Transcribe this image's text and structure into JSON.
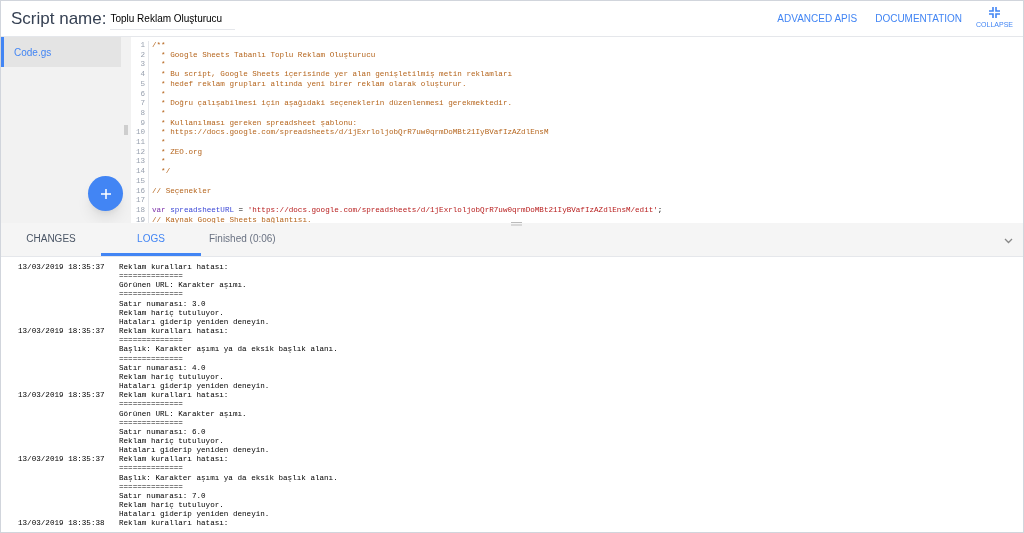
{
  "header": {
    "label": "Script name:",
    "script_name": "Toplu Reklam Oluşturucu",
    "links": [
      "ADVANCED APIS",
      "DOCUMENTATION"
    ],
    "collapse_label": "COLLAPSE"
  },
  "files": [
    {
      "name": "Code.gs",
      "selected": true
    }
  ],
  "editor": {
    "lines": [
      {
        "number": "1",
        "segments": [
          {
            "text": "/**",
            "kind": "comment"
          }
        ]
      },
      {
        "number": "2",
        "segments": [
          {
            "text": "  * Google Sheets Tabanlı Toplu Reklam Oluşturucu",
            "kind": "comment"
          }
        ]
      },
      {
        "number": "3",
        "segments": [
          {
            "text": "  *",
            "kind": "comment"
          }
        ]
      },
      {
        "number": "4",
        "segments": [
          {
            "text": "  * Bu script, Google Sheets içerisinde yer alan genişletilmiş metin reklamları",
            "kind": "comment"
          }
        ]
      },
      {
        "number": "5",
        "segments": [
          {
            "text": "  * hedef reklam grupları altında yeni birer reklam olarak oluşturur.",
            "kind": "comment"
          }
        ]
      },
      {
        "number": "6",
        "segments": [
          {
            "text": "  *",
            "kind": "comment"
          }
        ]
      },
      {
        "number": "7",
        "segments": [
          {
            "text": "  * Doğru çalışabilmesi için aşağıdaki seçeneklerin düzenlenmesi gerekmektedir.",
            "kind": "comment"
          }
        ]
      },
      {
        "number": "8",
        "segments": [
          {
            "text": "  *",
            "kind": "comment"
          }
        ]
      },
      {
        "number": "9",
        "segments": [
          {
            "text": "  * Kullanılması gereken spreadsheet şablonu:",
            "kind": "comment"
          }
        ]
      },
      {
        "number": "10",
        "segments": [
          {
            "text": "  * https://docs.google.com/spreadsheets/d/1jExrloljobQrR7uw0qrmDoMBt21IyBVafIzAZdlEnsM",
            "kind": "comment"
          }
        ]
      },
      {
        "number": "11",
        "segments": [
          {
            "text": "  *",
            "kind": "comment"
          }
        ]
      },
      {
        "number": "12",
        "segments": [
          {
            "text": "  * ZEO.org",
            "kind": "comment"
          }
        ]
      },
      {
        "number": "13",
        "segments": [
          {
            "text": "  *",
            "kind": "comment"
          }
        ]
      },
      {
        "number": "14",
        "segments": [
          {
            "text": "  */",
            "kind": "comment"
          }
        ]
      },
      {
        "number": "15"
      },
      {
        "number": "16",
        "segments": [
          {
            "text": "// Seçenekler",
            "kind": "comment"
          }
        ]
      },
      {
        "number": "17"
      },
      {
        "number": "18",
        "segments": [
          {
            "text": "var",
            "kind": "keyword"
          },
          {
            "text": " spreadsheetURL",
            "kind": "variable"
          },
          {
            "text": " = ",
            "kind": "plain"
          },
          {
            "text": "'https://docs.google.com/spreadsheets/d/1jExrloljobQrR7uw0qrmDoMBt21IyBVafIzAZdlEnsM/edit'",
            "kind": "string"
          },
          {
            "text": ";",
            "kind": "plain"
          }
        ]
      },
      {
        "number": "19",
        "segments": [
          {
            "text": "// Kaynak Google Sheets bağlantısı.",
            "kind": "comment"
          }
        ]
      }
    ]
  },
  "bottom_tabs": [
    {
      "label": "CHANGES",
      "selected": false
    },
    {
      "label": "LOGS",
      "selected": true
    }
  ],
  "status": "Finished (0:06)",
  "logs": [
    {
      "time": "13/03/2019 18:35:37",
      "lines": [
        "Reklam kuralları hatası:",
        "==============",
        "Görünen URL: Karakter aşımı.",
        "==============",
        "Satır numarası: 3.0",
        "Reklam hariç tutuluyor.",
        "Hataları giderip yeniden deneyin."
      ]
    },
    {
      "time": "13/03/2019 18:35:37",
      "lines": [
        "Reklam kuralları hatası:",
        "==============",
        "Başlık: Karakter aşımı ya da eksik başlık alanı.",
        "==============",
        "Satır numarası: 4.0",
        "Reklam hariç tutuluyor.",
        "Hataları giderip yeniden deneyin."
      ]
    },
    {
      "time": "13/03/2019 18:35:37",
      "lines": [
        "Reklam kuralları hatası:",
        "==============",
        "Görünen URL: Karakter aşımı.",
        "==============",
        "Satır numarası: 6.0",
        "Reklam hariç tutuluyor.",
        "Hataları giderip yeniden deneyin."
      ]
    },
    {
      "time": "13/03/2019 18:35:37",
      "lines": [
        "Reklam kuralları hatası:",
        "==============",
        "Başlık: Karakter aşımı ya da eksik başlık alanı.",
        "==============",
        "Satır numarası: 7.0",
        "Reklam hariç tutuluyor.",
        "Hataları giderip yeniden deneyin."
      ]
    },
    {
      "time": "13/03/2019 18:35:38",
      "lines": [
        "Reklam kuralları hatası:"
      ]
    }
  ]
}
